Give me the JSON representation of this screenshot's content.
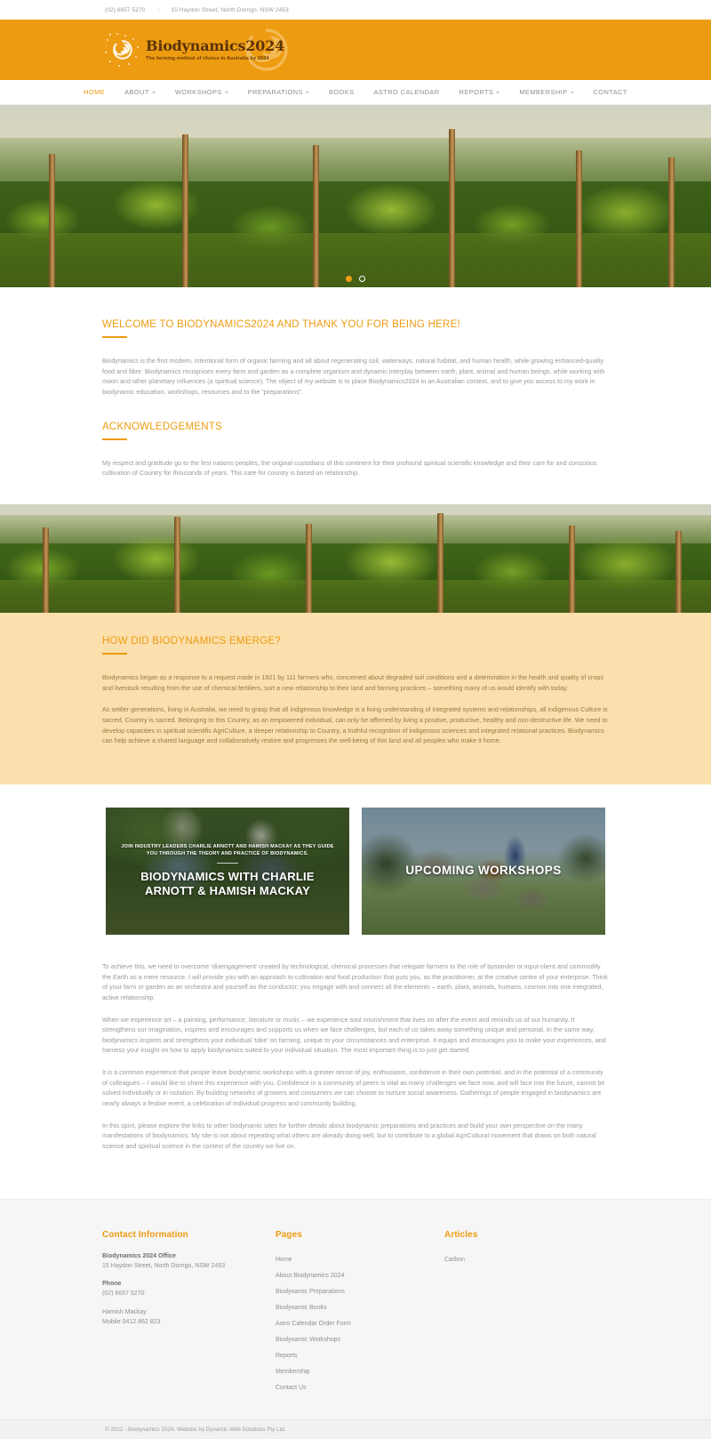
{
  "topbar": {
    "phone": "(02) 6657 5270",
    "address": "15 Haydon Street, North Dorrigo, NSW 2453"
  },
  "brand": {
    "title": "Biodynamics2024",
    "tagline": "The farming method of choice in Australia by 2024",
    "accent": "#ed9b10",
    "band_bg": "#ed9b10"
  },
  "nav": {
    "items": [
      {
        "label": "HOME",
        "has_caret": false,
        "active": true
      },
      {
        "label": "ABOUT",
        "has_caret": true,
        "active": false
      },
      {
        "label": "WORKSHOPS",
        "has_caret": true,
        "active": false
      },
      {
        "label": "PREPARATIONS",
        "has_caret": true,
        "active": false
      },
      {
        "label": "BOOKS",
        "has_caret": false,
        "active": false
      },
      {
        "label": "ASTRO CALENDAR",
        "has_caret": false,
        "active": false
      },
      {
        "label": "REPORTS",
        "has_caret": true,
        "active": false
      },
      {
        "label": "MEMBERSHIP",
        "has_caret": true,
        "active": false
      },
      {
        "label": "CONTACT",
        "has_caret": false,
        "active": false
      }
    ]
  },
  "hero": {
    "slides": 2,
    "active_slide": 1
  },
  "welcome": {
    "title": "WELCOME TO BIODYNAMICS2024 AND THANK YOU FOR BEING HERE!",
    "paragraph": "Biodynamics is the first modern, intentional form of organic farming and all about regenerating soil, waterways, natural habitat, and human health, while growing enhanced-quality food and fibre. Biodynamics recognises every farm and garden as a complete organism and dynamic interplay between earth, plant, animal and human beings, while working with moon and other planetary influences (a spiritual science). The object of my website is to place Biodynamics2024 in an Australian context, and to give you access to my work in biodynamic education, workshops, resources and to the “preparations”."
  },
  "acknowledgements": {
    "title": "ACKNOWLEDGEMENTS",
    "paragraph": "My respect and gratitude go to the first nations peoples, the original custodians of this continent for their profound spiritual scientific knowledge and their care for and conscious cultivation of Country for thousands of years. This care for country is based on relationship."
  },
  "emerge": {
    "title": "HOW DID BIODYNAMICS EMERGE?",
    "paragraph1": "Biodynamics began as a response to a request made in 1921 by 111 farmers who, concerned about degraded soil conditions and a deterioration in the health and quality of crops and livestock resulting from the use of chemical fertiliers, sort a new relationship to their land and farming practices – something many of us would identify with today.",
    "paragraph2": "As settler generations, living in Australia, we need to grasp that all indigenous knowledge is a living understanding of integrated systems and relationships, all indigenous Culture is sacred, Country is sacred. Belonging to this Country, as an empowered individual, can only be affirmed by living a positive, productive, healthy and non-destructive life. We need to develop capacities in spiritual scientific AgriCulture, a deeper relationship to Country, a truthful recognition of indigenous sciences and integrated relational practices. Biodynamics can help achieve a shared language and collaboratively restore and progresses the well-being of this land and all peoples who make it home."
  },
  "cards": [
    {
      "kicker": "JOIN INDUSTRY LEADERS CHARLIE ARNOTT AND HAMISH MACKAY AS THEY GUIDE YOU THROUGH THE THEORY AND PRACTICE OF BIODYNAMICS.",
      "title": "BIODYNAMICS WITH CHARLIE ARNOTT & HAMISH MACKAY"
    },
    {
      "kicker": "",
      "title": "UPCOMING WORKSHOPS"
    }
  ],
  "body": {
    "paragraph1": "To achieve this, we need to overcome ‘disengagement’ created by technological, chemical processes that relegate farmers to the role of bystander or input-client and commodify the Earth as a mere resource. I will provide you with an approach to cultivation and food production that puts you, as the practitioner, at the creative centre of your enterprise.  Think of your farm or garden as an orchestra and yourself as the conductor; you engage with and connect all the elements – earth, plant, animals, humans, cosmos into one integrated, active relationship.",
    "paragraph2": "When we experience art – a painting, performance, literature or music – we experience soul nourishment that lives on after the event and reminds us of our humanity. It strengthens our imagination, inspires and encourages and supports us when we face challenges, but each of us takes away something unique and personal. In the same way, biodynamics inspires and strengthens your individual ‘take’ on farming, unique to your circumstances and enterprise. It equips and encourages you to make your experiences, and harness your insight on how to apply biodynamics suited to your individual situation.  The most important thing is to just get started.",
    "paragraph3": "It is a common experience that people leave biodynamic workshops with a greater sense of joy, enthusiasm, confidence in their own potential, and in the potential of a community of colleagues – I would like to share this experience with you.  Confidence in a community of peers is vital as many challenges we face now, and will face into the future, cannot be solved individually or in isolation. By building networks of growers and consumers we can choose to nurture social awareness.  Gatherings of people engaged in biodynamics are nearly always a festive event, a celebration of individual progress and community building.",
    "paragraph4": "In this spirit, please explore the links to other biodynamic sites for further details about biodynamic preparations and practices and build your own perspective on the many manifestations of biodynamics. My site is not about repeating what others are already doing well, but to contribute to a global AgriCultural movement that draws on both natural science and spiritual science in the context of the country we live on."
  },
  "footer": {
    "contact": {
      "heading": "Contact Information",
      "office_name": "Biodynamics 2024 Office",
      "office_address": "15 Haydon Street, North Dorrigo, NSW 2453",
      "phone_label": "Phone",
      "phone_value": "(02) 6657 5270",
      "person_name": "Hamish Mackay",
      "person_mobile": "Mobile 0412 862 823"
    },
    "pages": {
      "heading": "Pages",
      "links": [
        "Home",
        "About Biodynamics 2024",
        "Biodynamic Preparations",
        "Biodynamic Books",
        "Astro Calendar Order Form",
        "Biodynamic Workshops",
        "Reports",
        "Membership",
        "Contact Us"
      ]
    },
    "articles": {
      "heading": "Articles",
      "links": [
        "Carbon"
      ]
    },
    "copyright": "© 2022 - Biodynamics 2024. Website by Dynamic Web Solutions Pty Ltd."
  }
}
